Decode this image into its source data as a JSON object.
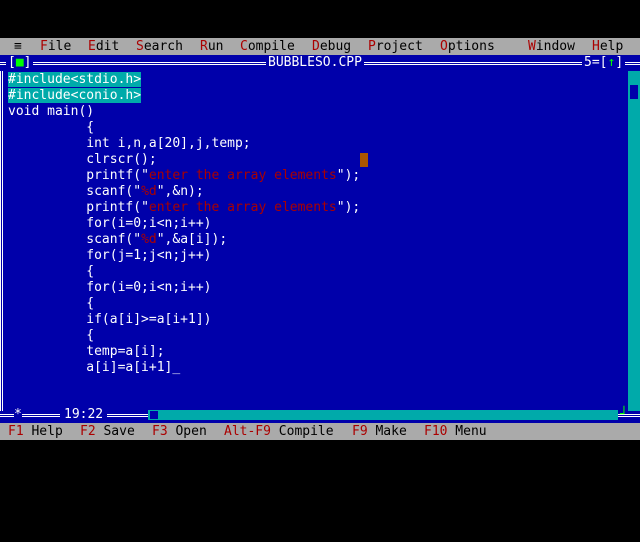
{
  "menu": {
    "system_glyph": "≡",
    "items": [
      {
        "hot": "F",
        "rest": "ile"
      },
      {
        "hot": "E",
        "rest": "dit"
      },
      {
        "hot": "S",
        "rest": "earch"
      },
      {
        "hot": "R",
        "rest": "un"
      },
      {
        "hot": "C",
        "rest": "ompile"
      },
      {
        "hot": "D",
        "rest": "ebug"
      },
      {
        "hot": "P",
        "rest": "roject"
      },
      {
        "hot": "O",
        "rest": "ptions"
      },
      {
        "hot": "W",
        "rest": "indow"
      },
      {
        "hot": "H",
        "rest": "elp"
      }
    ]
  },
  "window": {
    "close_box_left": "[",
    "close_box_glyph": "■",
    "close_box_right": "]",
    "title": "BUBBLESO.CPP",
    "number": "5",
    "up_arrow": "↑"
  },
  "code": {
    "lines": [
      "#include<stdio.h>",
      "#include<conio.h>",
      "void main()",
      "          {",
      "          int i,n,a[20],j,temp;",
      "          clrscr();",
      "          printf(\"enter the array elements\");",
      "          scanf(\"%d\",&n);",
      "          printf(\"enter the array elements\");",
      "          for(i=0;i<n;i++)",
      "          scanf(\"%d\",&a[i]);",
      "          for(j=1;j<n;j++)",
      "          {",
      "          for(i=0;i<n;i++)",
      "          {",
      "          if(a[i]>=a[i+1])",
      "          {",
      "          temp=a[i];",
      "          a[i]=a[i+1]_"
    ]
  },
  "status": {
    "position": "19:22",
    "modified_glyph": "*",
    "keys": [
      {
        "key": "F1",
        "label": " Help"
      },
      {
        "key": "F2",
        "label": " Save"
      },
      {
        "key": "F3",
        "label": " Open"
      },
      {
        "key": "Alt-F9",
        "label": " Compile"
      },
      {
        "key": "F9",
        "label": " Make"
      },
      {
        "key": "F10",
        "label": " Menu"
      }
    ]
  },
  "colors": {
    "editor_bg": "#0000aa",
    "menu_bg": "#aaaaaa",
    "hotkey": "#aa0000",
    "preprocessor_bg": "#00aaaa",
    "string": "#aa0000"
  }
}
